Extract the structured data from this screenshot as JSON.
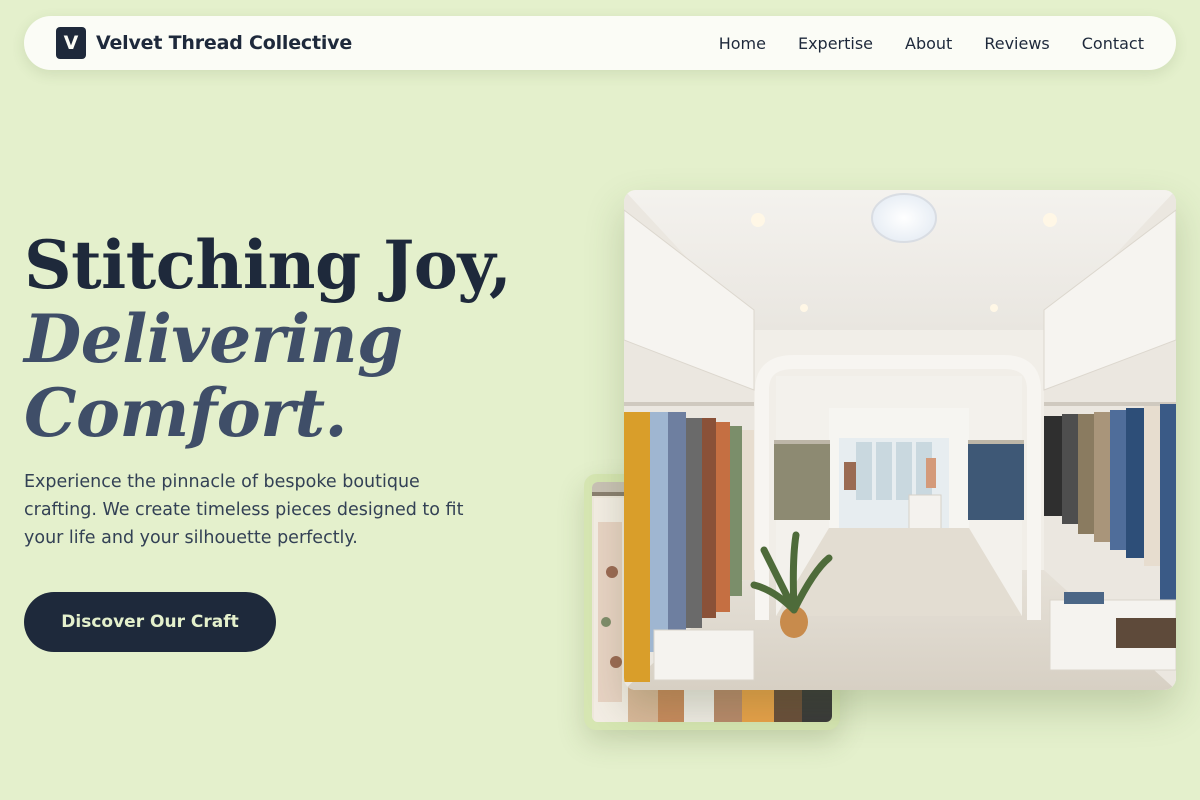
{
  "header": {
    "logo_letter": "V",
    "brand_name": "Velvet Thread Collective",
    "nav": [
      "Home",
      "Expertise",
      "About",
      "Reviews",
      "Contact"
    ]
  },
  "hero": {
    "title_line1": "Stitching Joy,",
    "title_line2": "Delivering",
    "title_line3": "Comfort.",
    "description": "Experience the pinnacle of bespoke boutique crafting. We create timeless pieces designed to fit your life and your silhouette perfectly.",
    "cta_label": "Discover Our Craft"
  },
  "colors": {
    "background": "#e4f0cc",
    "navy": "#1e293b",
    "slate": "#3f4e68"
  }
}
